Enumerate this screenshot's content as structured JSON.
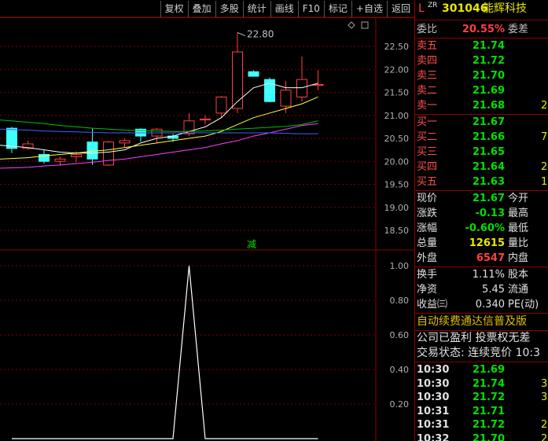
{
  "toolbar": {
    "buttons": [
      "复权",
      "叠加",
      "多股",
      "统计",
      "画线",
      "F10",
      "标记",
      "+自选",
      "返回"
    ]
  },
  "main_chart": {
    "high_marker": "22.80",
    "y_ticks": [
      "22.50",
      "22.00",
      "21.50",
      "21.00",
      "20.50",
      "20.00",
      "19.50",
      "19.00",
      "18.50"
    ],
    "reduce_marker": "减",
    "candles": [
      {
        "o": 20.72,
        "c": 20.28,
        "h": 20.75,
        "l": 20.18
      },
      {
        "o": 20.28,
        "c": 20.38,
        "h": 20.45,
        "l": 20.25
      },
      {
        "o": 20.15,
        "c": 20.0,
        "h": 20.25,
        "l": 19.95
      },
      {
        "o": 20.0,
        "c": 20.05,
        "h": 20.1,
        "l": 19.9
      },
      {
        "o": 20.1,
        "c": 20.15,
        "h": 20.22,
        "l": 19.98
      },
      {
        "o": 20.42,
        "c": 20.05,
        "h": 20.72,
        "l": 19.92
      },
      {
        "o": 19.92,
        "c": 20.42,
        "h": 20.45,
        "l": 19.9
      },
      {
        "o": 20.4,
        "c": 20.45,
        "h": 20.5,
        "l": 20.3
      },
      {
        "o": 20.7,
        "c": 20.55,
        "h": 20.72,
        "l": 20.42
      },
      {
        "o": 20.55,
        "c": 20.7,
        "h": 20.72,
        "l": 20.4
      },
      {
        "o": 20.55,
        "c": 20.5,
        "h": 20.6,
        "l": 20.42
      },
      {
        "o": 20.6,
        "c": 20.88,
        "h": 21.05,
        "l": 20.55
      },
      {
        "o": 20.9,
        "c": 20.92,
        "h": 21.0,
        "l": 20.8
      },
      {
        "o": 21.05,
        "c": 21.4,
        "h": 21.42,
        "l": 20.95
      },
      {
        "o": 21.15,
        "c": 22.38,
        "h": 22.8,
        "l": 21.05
      },
      {
        "o": 21.95,
        "c": 21.85,
        "h": 21.98,
        "l": 21.85
      },
      {
        "o": 21.78,
        "c": 21.3,
        "h": 21.82,
        "l": 21.28
      },
      {
        "o": 21.2,
        "c": 21.55,
        "h": 21.75,
        "l": 21.05
      },
      {
        "o": 21.4,
        "c": 21.78,
        "h": 22.28,
        "l": 21.3
      },
      {
        "o": 21.65,
        "c": 21.67,
        "h": 21.98,
        "l": 21.55
      }
    ],
    "ma_lines": [
      {
        "color": "#ffffff",
        "values": [
          20.35,
          20.3,
          20.25,
          20.2,
          20.18,
          20.18,
          20.2,
          20.25,
          20.4,
          20.5,
          20.55,
          20.65,
          20.75,
          20.95,
          21.3,
          21.6,
          21.7,
          21.6,
          21.6,
          21.7
        ]
      },
      {
        "color": "#ffff40",
        "values": [
          20.05,
          20.08,
          20.12,
          20.15,
          20.18,
          20.22,
          20.25,
          20.3,
          20.35,
          20.4,
          20.45,
          20.5,
          20.55,
          20.65,
          20.8,
          20.95,
          21.05,
          21.15,
          21.25,
          21.4
        ]
      },
      {
        "color": "#ff40ff",
        "values": [
          19.85,
          19.87,
          19.9,
          19.92,
          19.95,
          19.98,
          20.02,
          20.05,
          20.1,
          20.15,
          20.2,
          20.25,
          20.3,
          20.38,
          20.45,
          20.55,
          20.62,
          20.7,
          20.78,
          20.82
        ]
      },
      {
        "color": "#00c000",
        "values": [
          20.9,
          20.85,
          20.82,
          20.78,
          20.75,
          20.72,
          20.7,
          20.68,
          20.67,
          20.66,
          20.65,
          20.65,
          20.66,
          20.68,
          20.7,
          20.72,
          20.74,
          20.76,
          20.8,
          20.88
        ]
      },
      {
        "color": "#4060ff",
        "values": [
          20.7,
          20.68,
          20.66,
          20.65,
          20.64,
          20.63,
          20.62,
          20.62,
          20.62,
          20.62,
          20.62,
          20.62,
          20.62,
          20.62,
          20.62,
          20.62,
          20.62,
          20.61,
          20.6,
          20.6
        ]
      }
    ]
  },
  "indicator_chart": {
    "y_ticks": [
      "1.00",
      "0.80",
      "0.60",
      "0.40",
      "0.20"
    ],
    "values": [
      0,
      0,
      0,
      0,
      0,
      0,
      0,
      0,
      0,
      0,
      0,
      1,
      0,
      0,
      0,
      0,
      0,
      0,
      0,
      0
    ]
  },
  "quote": {
    "prefix": "L",
    "superscript": "ZR",
    "code": "301046",
    "name": "能辉科技",
    "committee_ratio_label": "委比",
    "committee_ratio": "20.55%",
    "committee_diff_label": "委差",
    "asks": [
      {
        "label": "卖五",
        "price": "21.74"
      },
      {
        "label": "卖四",
        "price": "21.72"
      },
      {
        "label": "卖三",
        "price": "21.70"
      },
      {
        "label": "卖二",
        "price": "21.69"
      },
      {
        "label": "卖一",
        "price": "21.68",
        "extra": "2"
      }
    ],
    "bids": [
      {
        "label": "买一",
        "price": "21.67"
      },
      {
        "label": "买二",
        "price": "21.66",
        "extra": "7"
      },
      {
        "label": "买三",
        "price": "21.65"
      },
      {
        "label": "买四",
        "price": "21.64",
        "extra": "2"
      },
      {
        "label": "买五",
        "price": "21.63",
        "extra": "1"
      }
    ],
    "stats": [
      {
        "label": "现价",
        "value": "21.67",
        "label2": "今开",
        "color": "green"
      },
      {
        "label": "涨跌",
        "value": "-0.13",
        "label2": "最高",
        "color": "green"
      },
      {
        "label": "涨幅",
        "value": "-0.60%",
        "label2": "最低",
        "color": "green"
      },
      {
        "label": "总量",
        "value": "12615",
        "label2": "量比",
        "color": "yellow"
      },
      {
        "label": "外盘",
        "value": "6547",
        "label2": "内盘",
        "color": "red"
      }
    ],
    "stats2": [
      {
        "label": "换手",
        "value": "1.11%",
        "label2": "股本"
      },
      {
        "label": "净资",
        "value": "5.45",
        "label2": "流通"
      },
      {
        "label": "收益㈢",
        "value": "0.340",
        "label2": "PE(动)"
      }
    ],
    "promo": "自动续费通达信普及版",
    "news": "公司已盈利 投票权无差",
    "trade_status": "交易状态: 连续竞价 10:3",
    "ticks": [
      {
        "time": "10:30",
        "price": "21.69",
        "extra": ""
      },
      {
        "time": "10:30",
        "price": "21.74",
        "extra": "3"
      },
      {
        "time": "10:30",
        "price": "21.72",
        "extra": "3"
      },
      {
        "time": "10:31",
        "price": "21.71",
        "extra": ""
      },
      {
        "time": "10:31",
        "price": "21.72",
        "extra": "2"
      },
      {
        "time": "10:32",
        "price": "21.70",
        "extra": "2"
      }
    ]
  }
}
